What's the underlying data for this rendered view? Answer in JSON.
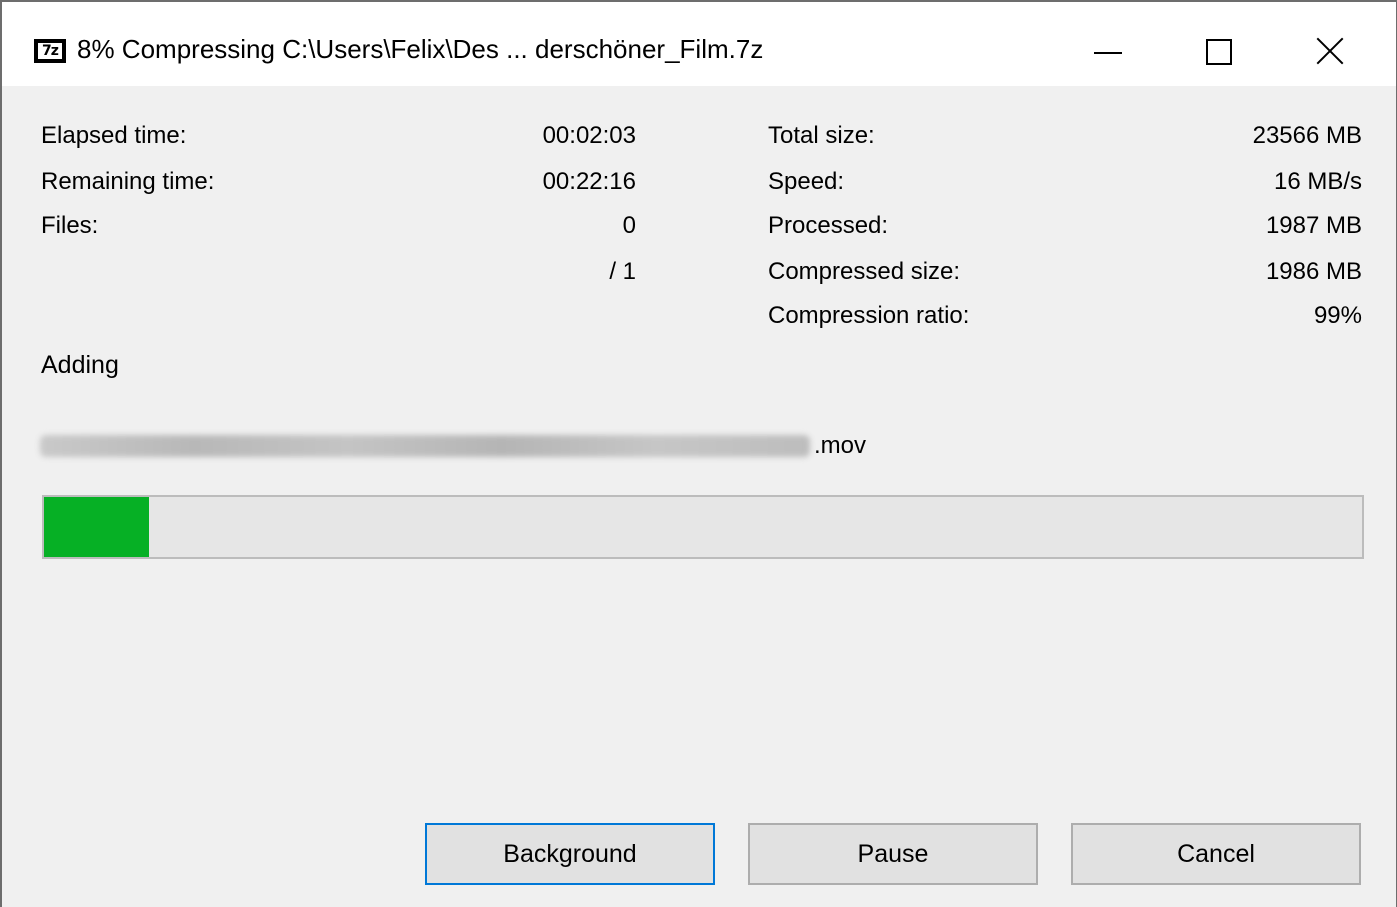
{
  "window": {
    "title": "8% Compressing C:\\Users\\Felix\\Des ... derschöner_Film.7z",
    "icon_text": "7z",
    "controls": [
      "minimize-icon",
      "maximize-icon",
      "close-icon"
    ]
  },
  "stats_left": {
    "elapsed_label": "Elapsed time:",
    "elapsed_value": "00:02:03",
    "remaining_label": "Remaining time:",
    "remaining_value": "00:22:16",
    "files_label": "Files:",
    "files_value": "0",
    "files_total": "/ 1"
  },
  "stats_right": {
    "total_size_label": "Total size:",
    "total_size_value": "23566 MB",
    "speed_label": "Speed:",
    "speed_value": "16 MB/s",
    "processed_label": "Processed:",
    "processed_value": "1987 MB",
    "compressed_size_label": "Compressed size:",
    "compressed_size_value": "1986 MB",
    "ratio_label": "Compression ratio:",
    "ratio_value": "99%"
  },
  "status": {
    "action": "Adding",
    "file_extension": ".mov"
  },
  "progress": {
    "percent": 8,
    "color": "#06b025"
  },
  "buttons": {
    "background": "Background",
    "pause": "Pause",
    "cancel": "Cancel"
  }
}
